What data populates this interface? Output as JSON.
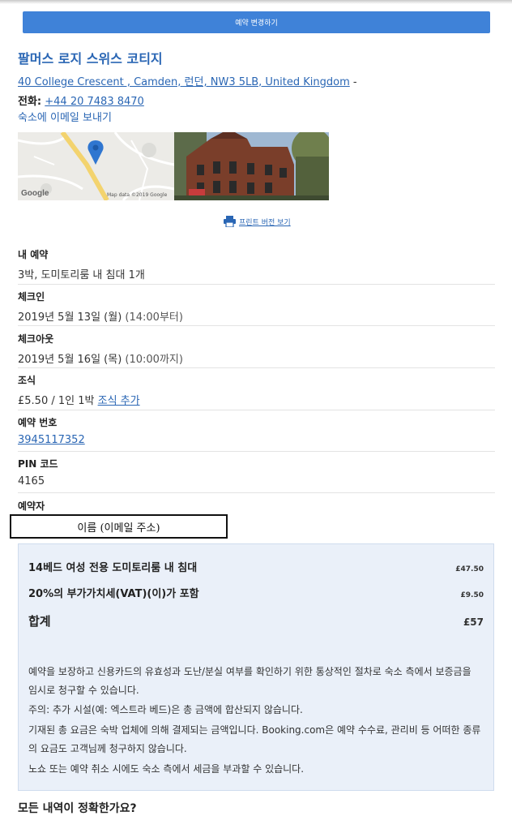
{
  "actions": {
    "modify_booking": "예약 변경하기"
  },
  "hotel": {
    "name": "팔머스 로지 스위스 코티지",
    "address": "40 College Crescent , Camden, 런던, NW3 5LB, United Kingdom",
    "address_suffix": "-",
    "phone_label": "전화:",
    "phone": "+44 20 7483 8470",
    "email_link": "숙소에 이메일 보내기"
  },
  "map": {
    "provider": "Google",
    "attribution": "Map data ©2019 Google"
  },
  "print": {
    "label": "프린트 버전 보기",
    "icon": "printer-icon"
  },
  "details": [
    {
      "label": "내 예약",
      "value": "3박, 도미토리룸 내 침대 1개"
    },
    {
      "label": "체크인",
      "value": "2019년 5월 13일 (월)",
      "extra": "(14:00부터)"
    },
    {
      "label": "체크아웃",
      "value": "2019년 5월 16일 (목)",
      "extra": "(10:00까지)"
    },
    {
      "label": "조식",
      "value": "£5.50 / 1인 1박",
      "link": "조식 추가"
    },
    {
      "label": "예약 번호",
      "value": "3945117352"
    },
    {
      "label": "PIN 코드",
      "value": "4165"
    },
    {
      "label": "예약자",
      "value": ""
    }
  ],
  "booker_redacted": "이름 (이메일 주소)",
  "summary": {
    "lines": [
      {
        "label": "14베드 여성 전용 도미토리룸 내 침대",
        "amount": "£47.50"
      },
      {
        "label": "20%의 부가가치세(VAT)(이)가 포함",
        "amount": "£9.50"
      }
    ],
    "total_label": "합계",
    "total_amount": "£57",
    "notes": [
      "예약을 보장하고 신용카드의 유효성과 도난/분실 여부를 확인하기 위한 통상적인 절차로 숙소 측에서 보증금을 임시로 청구할 수 있습니다.",
      "주의: 추가 시설(예: 엑스트라 베드)은 총 금액에 합산되지 않습니다.",
      "기재된 총 요금은 숙박 업체에 의해 결제되는 금액입니다. Booking.com은 예약 수수료, 관리비 등 어떠한 종류의 요금도 고객님께 청구하지 않습니다.",
      "노쇼 또는 예약 취소 시에도 숙소 측에서 세금을 부과할 수 있습니다."
    ]
  },
  "bottom_heading": "모든 내역이 정확한가요?"
}
